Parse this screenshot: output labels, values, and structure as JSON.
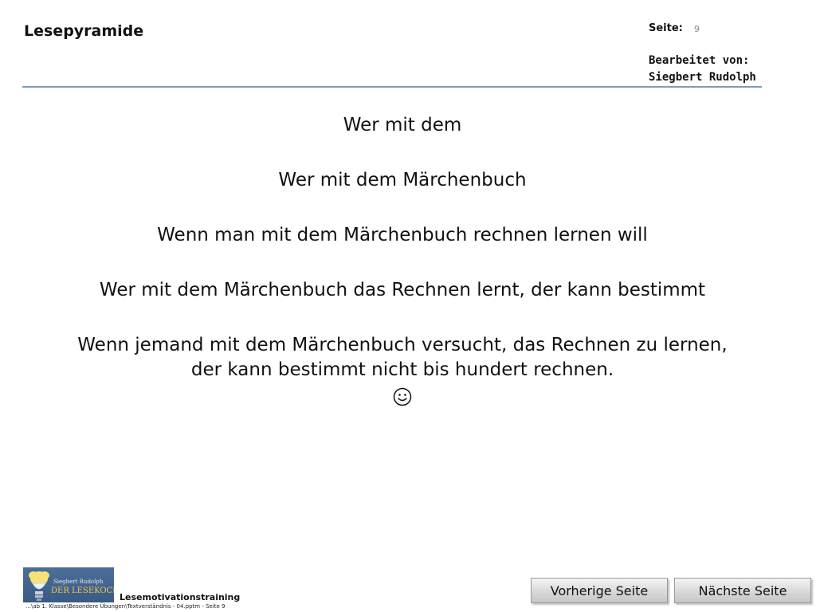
{
  "header": {
    "title": "Lesepyramide",
    "page_label": "Seite:",
    "page_number": "9",
    "edited_by_label": "Bearbeitet von:",
    "edited_by_name": "Siegbert Rudolph"
  },
  "pyramid": {
    "lines": [
      "Wer mit dem",
      "Wer mit dem Märchenbuch",
      "Wenn man mit dem Märchenbuch rechnen lernen will",
      "Wer mit dem Märchenbuch das Rechnen lernt, der kann bestimmt",
      "Wenn jemand mit dem Märchenbuch versucht, das Rechnen zu lernen,",
      "der kann bestimmt nicht bis hundert rechnen."
    ],
    "emoji_icon": "smiley-face-icon"
  },
  "footer": {
    "logo_small_text": "Siegbert Rudolph",
    "logo_big_text": "DER LESEKOCH",
    "training_label": "Lesemotivationstraining",
    "path": "…\\ab 1. Klasse\\Besondere Übungen\\Textverständnis - 04.pptm - Seite 9",
    "prev_button": "Vorherige Seite",
    "next_button": "Nächste Seite"
  },
  "colors": {
    "header_rule": "#7f9bbd",
    "logo_background": "#3a5a83",
    "logo_accent": "#f2c94c"
  }
}
